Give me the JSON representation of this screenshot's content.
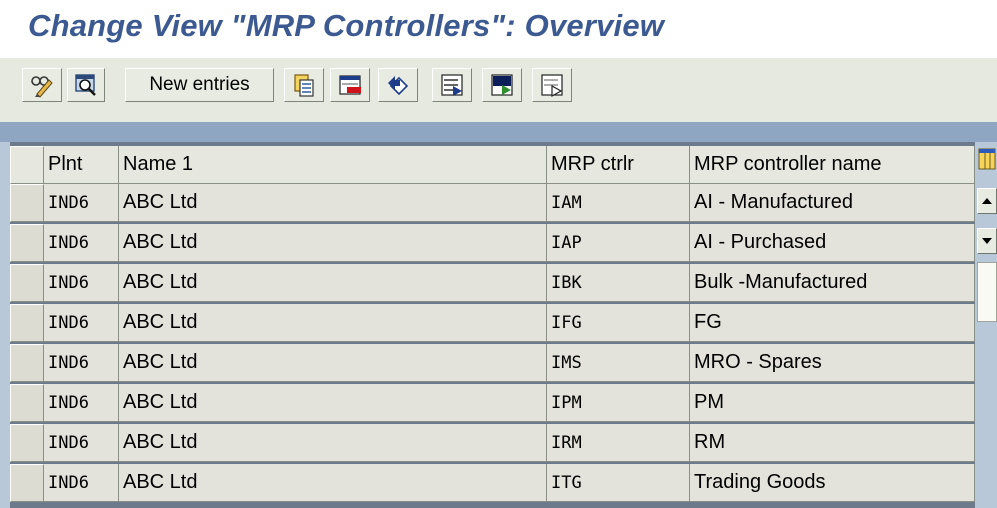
{
  "title": "Change View \"MRP Controllers\": Overview",
  "toolbar": {
    "display_change_icon": "pencil-glasses-icon",
    "detail_icon": "magnifier-detail-icon",
    "new_entries_label": "New entries",
    "copy_icon": "copy-icon",
    "delete_icon": "delete-icon",
    "undo_icon": "undo-icon",
    "select_all_icon": "select-all-icon",
    "select_block_icon": "select-block-icon",
    "deselect_all_icon": "deselect-all-icon"
  },
  "table": {
    "headers": {
      "plnt": "Plnt",
      "name1": "Name 1",
      "mrp_ctrlr": "MRP ctrlr",
      "mrp_controller_name": "MRP controller name"
    },
    "rows": [
      {
        "plnt": "IND6",
        "name1": "ABC Ltd",
        "mrp_ctrlr": "IAM",
        "mrp_controller_name": "AI - Manufactured"
      },
      {
        "plnt": "IND6",
        "name1": "ABC Ltd",
        "mrp_ctrlr": "IAP",
        "mrp_controller_name": "AI - Purchased"
      },
      {
        "plnt": "IND6",
        "name1": "ABC Ltd",
        "mrp_ctrlr": "IBK",
        "mrp_controller_name": "Bulk -Manufactured"
      },
      {
        "plnt": "IND6",
        "name1": "ABC Ltd",
        "mrp_ctrlr": "IFG",
        "mrp_controller_name": "FG"
      },
      {
        "plnt": "IND6",
        "name1": "ABC Ltd",
        "mrp_ctrlr": "IMS",
        "mrp_controller_name": "MRO - Spares"
      },
      {
        "plnt": "IND6",
        "name1": "ABC Ltd",
        "mrp_ctrlr": "IPM",
        "mrp_controller_name": "PM"
      },
      {
        "plnt": "IND6",
        "name1": "ABC Ltd",
        "mrp_ctrlr": "IRM",
        "mrp_controller_name": "RM"
      },
      {
        "plnt": "IND6",
        "name1": "ABC Ltd",
        "mrp_ctrlr": "ITG",
        "mrp_controller_name": "Trading Goods"
      }
    ]
  },
  "colors": {
    "title": "#3c5a91",
    "toolbar_bg": "#e6e9e0",
    "table_bg": "#b9c8d9",
    "cell_bg": "#e3e3db"
  }
}
